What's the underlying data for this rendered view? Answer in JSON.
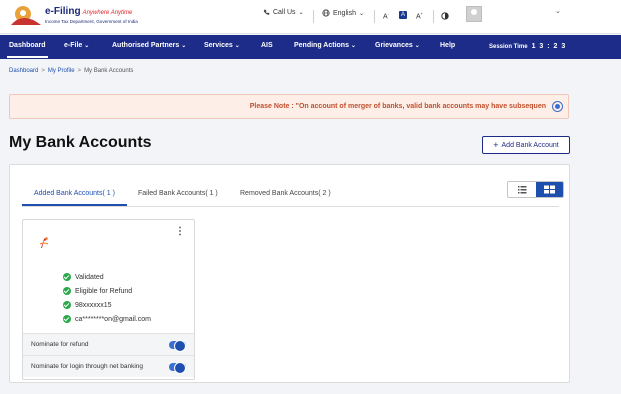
{
  "header": {
    "logo_title": "e-Filing",
    "logo_tagline": "Anywhere Anytime",
    "logo_subtitle": "Income Tax Department, Government of India",
    "call_us": "Call Us",
    "language": "English",
    "font_small": "A",
    "font_medium": "A",
    "font_large": "A"
  },
  "nav": {
    "items": [
      {
        "label": "Dashboard"
      },
      {
        "label": "e-File"
      },
      {
        "label": "Authorised Partners"
      },
      {
        "label": "Services"
      },
      {
        "label": "AIS"
      },
      {
        "label": "Pending Actions"
      },
      {
        "label": "Grievances"
      },
      {
        "label": "Help"
      }
    ],
    "session_label": "Session Time",
    "session_value": "1 3 : 2 3"
  },
  "breadcrumb": {
    "items": [
      "Dashboard",
      "My Profile",
      "My Bank Accounts"
    ]
  },
  "notice": {
    "text": "Please Note : \"On account of merger of banks, valid bank accounts may have subsequen"
  },
  "page": {
    "title": "My Bank Accounts",
    "add_button": "Add Bank Account"
  },
  "tabs": [
    {
      "label": "Added Bank Accounts( 1 )"
    },
    {
      "label": "Failed Bank Accounts( 1 )"
    },
    {
      "label": "Removed Bank Accounts( 2 )"
    }
  ],
  "card": {
    "details": [
      "Validated",
      "Eligible for Refund",
      "98xxxxxx15",
      "ca********on@gmail.com"
    ],
    "toggles": [
      {
        "label": "Nominate for refund",
        "on": true
      },
      {
        "label": "Nominate for login through net banking",
        "on": true
      }
    ]
  },
  "colors": {
    "nav_bg": "#1d2c88",
    "accent": "#1d4fae",
    "success": "#2aa84a",
    "notice_text": "#c0502e"
  }
}
